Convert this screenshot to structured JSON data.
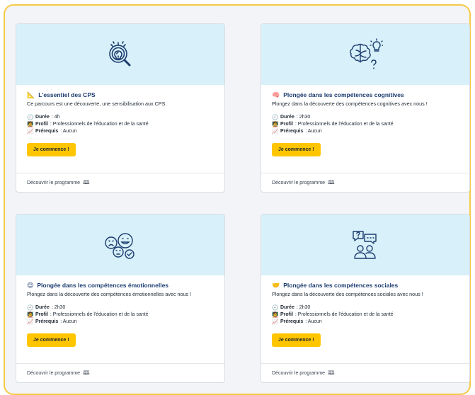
{
  "cards": [
    {
      "icon_name": "brain-magnifier-icon",
      "emoji": "📐",
      "title": "L'essentiel des CPS",
      "description": "Ce parcours est une découverte, une sensibilisation aux CPS.",
      "duration_label": "Durée",
      "duration": " : 4h",
      "profile_label": "Profil",
      "profile": " : Professionnels de l'éducation et de la santé",
      "prereq_label": "Prérequis",
      "prereq": " : Aucun",
      "cta": "Je commence !",
      "footer_link": "Découvrir le programme"
    },
    {
      "icon_name": "brain-lightbulb-icon",
      "emoji": "🧠",
      "title": "Plongée dans les compétences cognitives",
      "description": "Plongez dans la découverte des compétences cognitives avec nous !",
      "duration_label": "Durée",
      "duration": " : 2h30",
      "profile_label": "Profil",
      "profile": " : Professionnels de l'éducation et de la santé",
      "prereq_label": "Prérequis",
      "prereq": " : Aucun",
      "cta": "Je commence !",
      "footer_link": "Découvrir le programme"
    },
    {
      "icon_name": "emotion-faces-icon",
      "emoji": "😊",
      "title": "Plongée dans les compétences émotionnelles",
      "description": "Plongez dans la découverte des compétences émotionnelles avec nous !",
      "duration_label": "Durée",
      "duration": " : 2h30",
      "profile_label": "Profil",
      "profile": " : Professionnels de l'éducation et de la santé",
      "prereq_label": "Prérequis",
      "prereq": " : Aucun",
      "cta": "Je commence !",
      "footer_link": "Découvrir le programme"
    },
    {
      "icon_name": "people-chat-icon",
      "emoji": "🤝",
      "title": "Plongée dans les compétences sociales",
      "description": "Plongez dans la découverte des compétences sociales avec nous !",
      "duration_label": "Durée",
      "duration": " : 2h30",
      "profile_label": "Profil",
      "profile": " : Professionnels de l'éducation et de la santé",
      "prereq_label": "Prérequis",
      "prereq": " : Aucun",
      "cta": "Je commence !",
      "footer_link": "Découvrir le programme"
    }
  ],
  "meta_icons": {
    "duration": "clock-icon",
    "profile": "person-icon",
    "prereq": "chart-icon"
  },
  "colors": {
    "hero_bg": "#d7f0f9",
    "title": "#1b3b6f",
    "cta_bg": "#ffc600",
    "frame_border": "#f6c945",
    "icon_stroke": "#1b3b6f"
  }
}
